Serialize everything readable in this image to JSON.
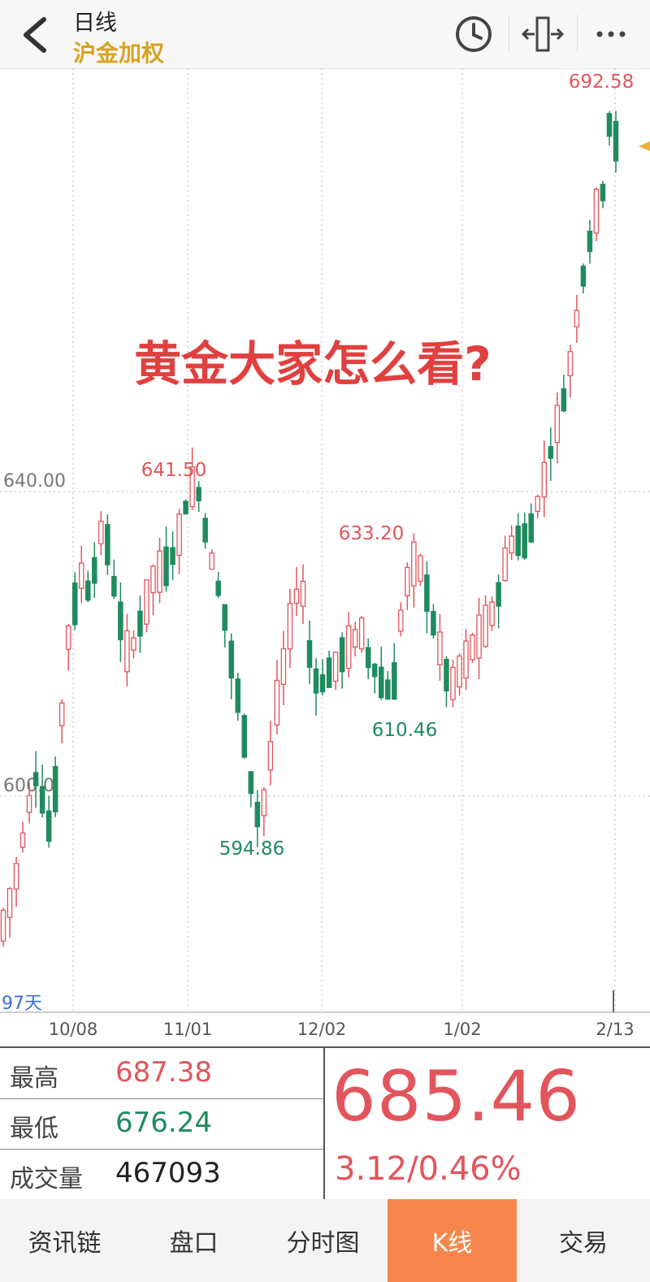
{
  "header": {
    "title": "日线",
    "subtitle": "沪金加权"
  },
  "chart_data": {
    "type": "candlestick",
    "x_ticks": [
      "10/08",
      "11/01",
      "12/02",
      "1/02",
      "2/13"
    ],
    "y_ticks": [
      {
        "label": "640.00",
        "value": 640
      },
      {
        "label": "600.0",
        "value": 600
      }
    ],
    "ylim": [
      575,
      690
    ],
    "bottom_left_label": "97天",
    "annotations": [
      {
        "label": "692.58",
        "type": "high"
      },
      {
        "label": "641.50",
        "type": "high"
      },
      {
        "label": "633.20",
        "type": "high"
      },
      {
        "label": "610.46",
        "type": "low"
      },
      {
        "label": "594.86",
        "type": "low"
      }
    ],
    "overlay_text": "黄金大家怎么看?",
    "colors": {
      "up": "#e2555c",
      "down": "#1f8b5f"
    }
  },
  "stats": {
    "high_label": "最高",
    "high_value": "687.38",
    "low_label": "最低",
    "low_value": "676.24",
    "volume_label": "成交量",
    "volume_value": "467093",
    "last_price": "685.46",
    "change": "3.12/0.46%"
  },
  "tabs": [
    {
      "label": "资讯链"
    },
    {
      "label": "盘口"
    },
    {
      "label": "分时图"
    },
    {
      "label": "K线"
    },
    {
      "label": "交易"
    }
  ]
}
